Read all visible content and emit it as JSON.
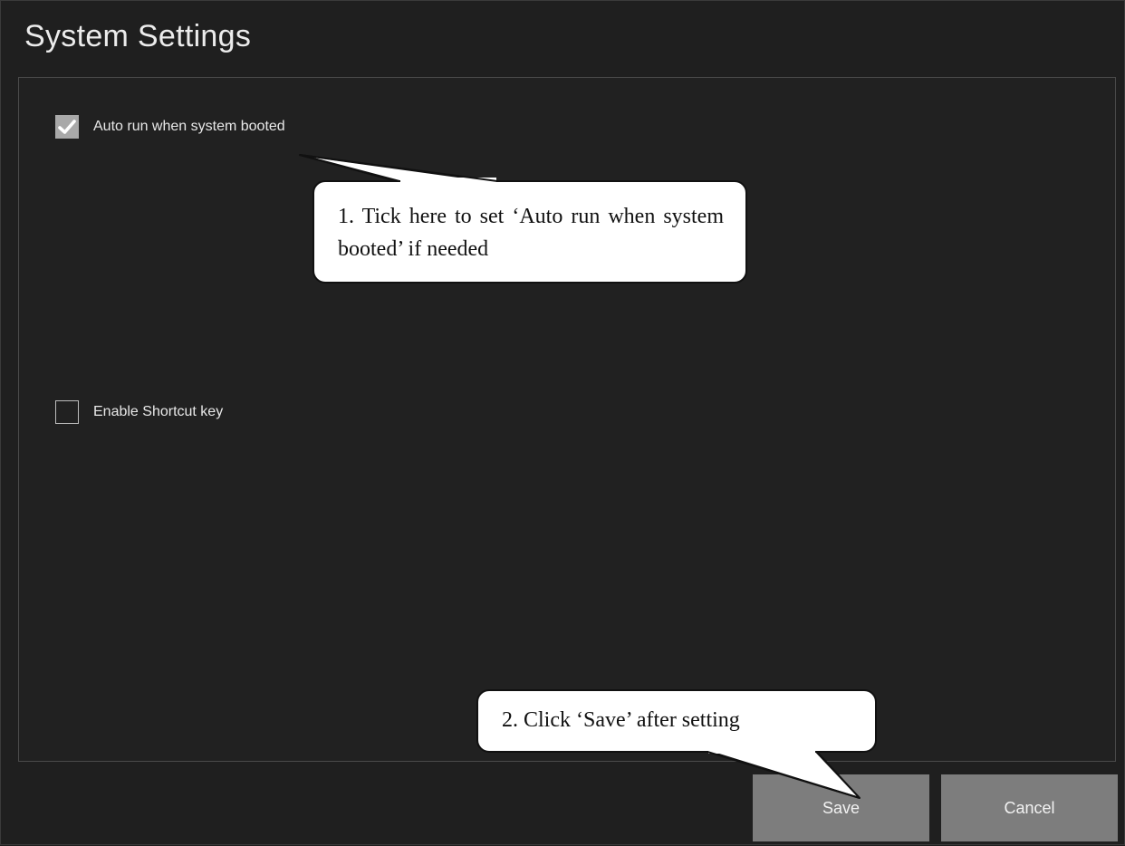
{
  "window": {
    "title": "System Settings"
  },
  "options": {
    "auto_run": {
      "label": "Auto run when system booted",
      "checked": true
    },
    "shortcut": {
      "label": "Enable Shortcut key",
      "checked": false
    }
  },
  "buttons": {
    "save_label": "Save",
    "cancel_label": "Cancel"
  },
  "callouts": {
    "step1": "1. Tick here to set ‘Auto run when system booted’ if needed",
    "step2": "2. Click ‘Save’ after setting"
  },
  "colors": {
    "background": "#1f1f1f",
    "checkbox_checked": "#a9a9a9",
    "button": "#7d7d7d",
    "callout_bg": "#ffffff"
  },
  "icons": {
    "checkmark": "check-icon"
  }
}
